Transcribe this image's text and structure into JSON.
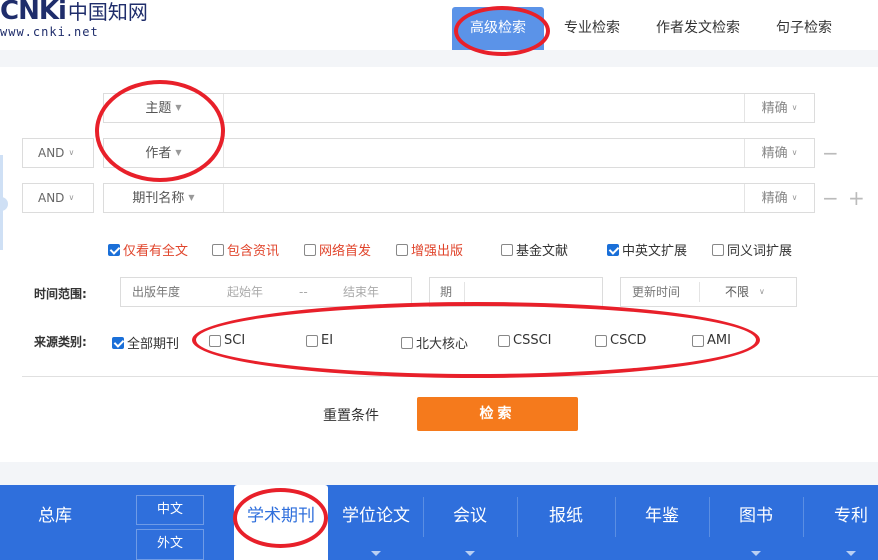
{
  "logo": {
    "mark": "CNKi",
    "cn": "中国知网",
    "url": "www.cnki.net"
  },
  "top_tabs": [
    "高级检索",
    "专业检索",
    "作者发文检索",
    "句子检索"
  ],
  "rows": [
    {
      "logic": "",
      "field": "主题",
      "exact": "精确"
    },
    {
      "logic": "AND",
      "field": "作者",
      "exact": "精确"
    },
    {
      "logic": "AND",
      "field": "期刊名称",
      "exact": "精确"
    }
  ],
  "row_buttons": {
    "minus": "−",
    "plus": "+"
  },
  "options": [
    {
      "label": "仅看有全文",
      "checked": true,
      "red": true
    },
    {
      "label": "包含资讯",
      "checked": false,
      "red": true
    },
    {
      "label": "网络首发",
      "checked": false,
      "red": true
    },
    {
      "label": "增强出版",
      "checked": false,
      "red": true
    },
    {
      "label": "基金文献",
      "checked": false,
      "red": false
    },
    {
      "label": "中英文扩展",
      "checked": true,
      "red": false
    },
    {
      "label": "同义词扩展",
      "checked": false,
      "red": false
    }
  ],
  "time": {
    "label": "时间范围:",
    "year_label": "出版年度",
    "start_placeholder": "起始年",
    "sep": "--",
    "end_placeholder": "结束年",
    "issue_label": "期",
    "update_label": "更新时间",
    "update_value": "不限"
  },
  "source": {
    "label": "来源类别:",
    "items": [
      {
        "label": "全部期刊",
        "checked": true
      },
      {
        "label": "SCI",
        "checked": false
      },
      {
        "label": "EI",
        "checked": false
      },
      {
        "label": "北大核心",
        "checked": false
      },
      {
        "label": "CSSCI",
        "checked": false
      },
      {
        "label": "CSCD",
        "checked": false
      },
      {
        "label": "AMI",
        "checked": false
      }
    ]
  },
  "actions": {
    "reset": "重置条件",
    "search": "检索"
  },
  "nav": {
    "items": [
      "总库",
      "学术期刊",
      "学位论文",
      "会议",
      "报纸",
      "年鉴",
      "图书",
      "专利"
    ],
    "lang": [
      "中文",
      "外文"
    ]
  },
  "colors": {
    "accent": "#2f6fdc",
    "search_button": "#f57a1c",
    "annotation": "#e8202a"
  }
}
